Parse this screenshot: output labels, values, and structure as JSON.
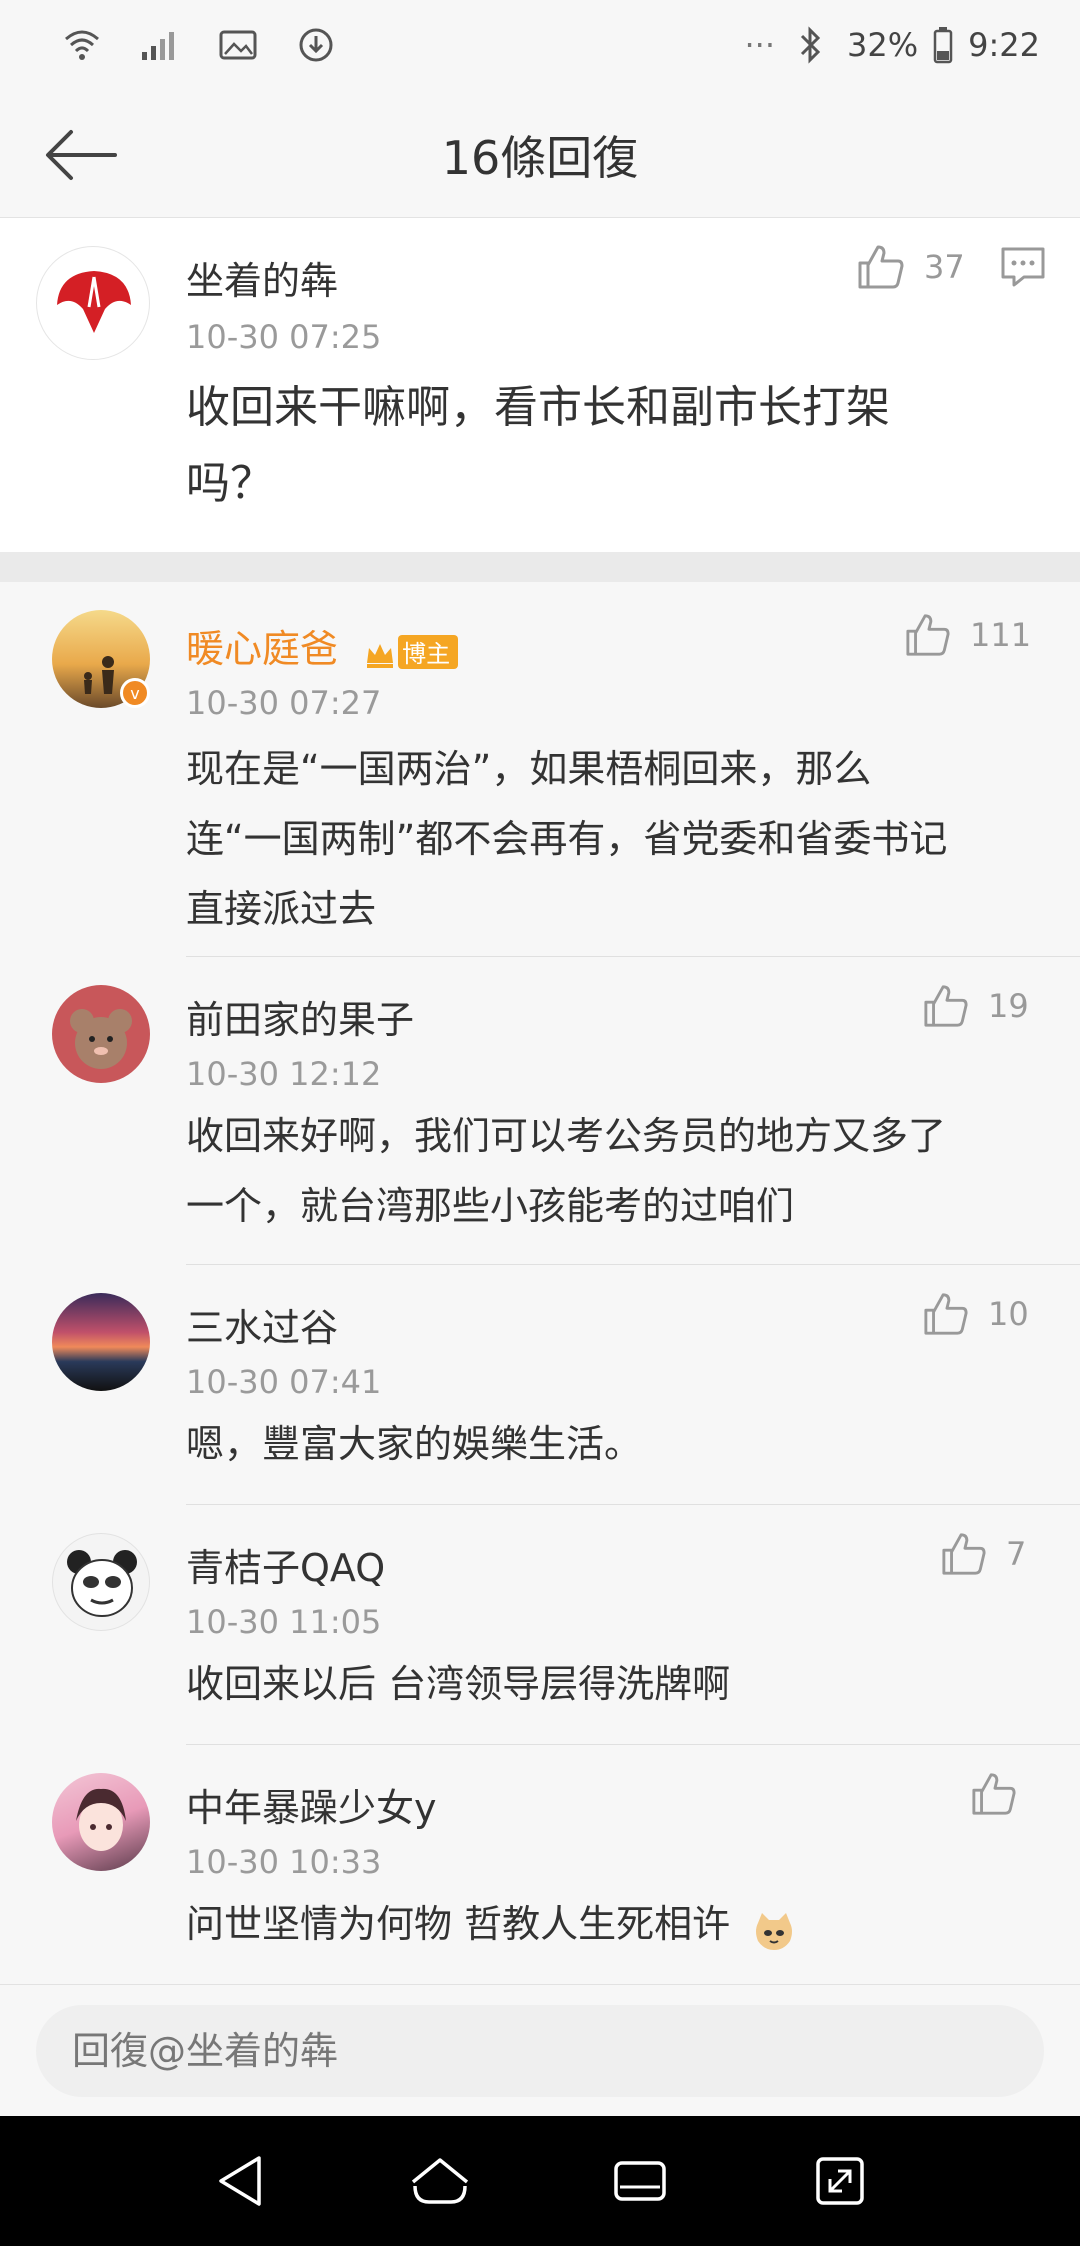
{
  "status_bar": {
    "dots": "···",
    "battery": "32%",
    "time": "9:22",
    "icons": [
      "wifi-icon",
      "signal-icon",
      "gallery-icon",
      "download-icon",
      "bluetooth-icon",
      "battery-icon"
    ]
  },
  "header": {
    "title": "16條回復",
    "back_icon": "arrow-left-icon"
  },
  "original": {
    "name": "坐着的犇",
    "time": "10-30 07:25",
    "text_line1": "收回来干嘛啊，看市长和副市长打架",
    "text_line2": "吗？",
    "likes": "37",
    "avatar_color": "#d41f25"
  },
  "replies": [
    {
      "name": "暖心庭爸",
      "badge": "博主",
      "time": "10-30 07:27",
      "lines": [
        "现在是“一国两治”，如果梧桐回来，那么",
        "连“一国两制”都不会再有，省党委和省委书记",
        "直接派过去"
      ],
      "likes": "111",
      "name_color": "#f08a24"
    },
    {
      "name": "前田家的果子",
      "time": "10-30 12:12",
      "lines": [
        "收回来好啊，我们可以考公务员的地方又多了",
        "一个，就台湾那些小孩能考的过咱们"
      ],
      "likes": "19"
    },
    {
      "name": "三水过谷",
      "time": "10-30 07:41",
      "lines": [
        "嗯，豐富大家的娛樂生活。"
      ],
      "likes": "10"
    },
    {
      "name": "青桔子QAQ",
      "time": "10-30 11:05",
      "lines": [
        "收回来以后 台湾领导层得洗牌啊"
      ],
      "likes": "7"
    },
    {
      "name": "中年暴躁少女y",
      "time": "10-30 10:33",
      "lines": [
        "问世坚情为何物 哲教人生死相许"
      ],
      "likes": ""
    }
  ],
  "input": {
    "placeholder": "回復@坐着的犇"
  },
  "navbar": {
    "icons": [
      "back-nav-icon",
      "home-nav-icon",
      "recents-nav-icon",
      "expand-nav-icon"
    ]
  }
}
